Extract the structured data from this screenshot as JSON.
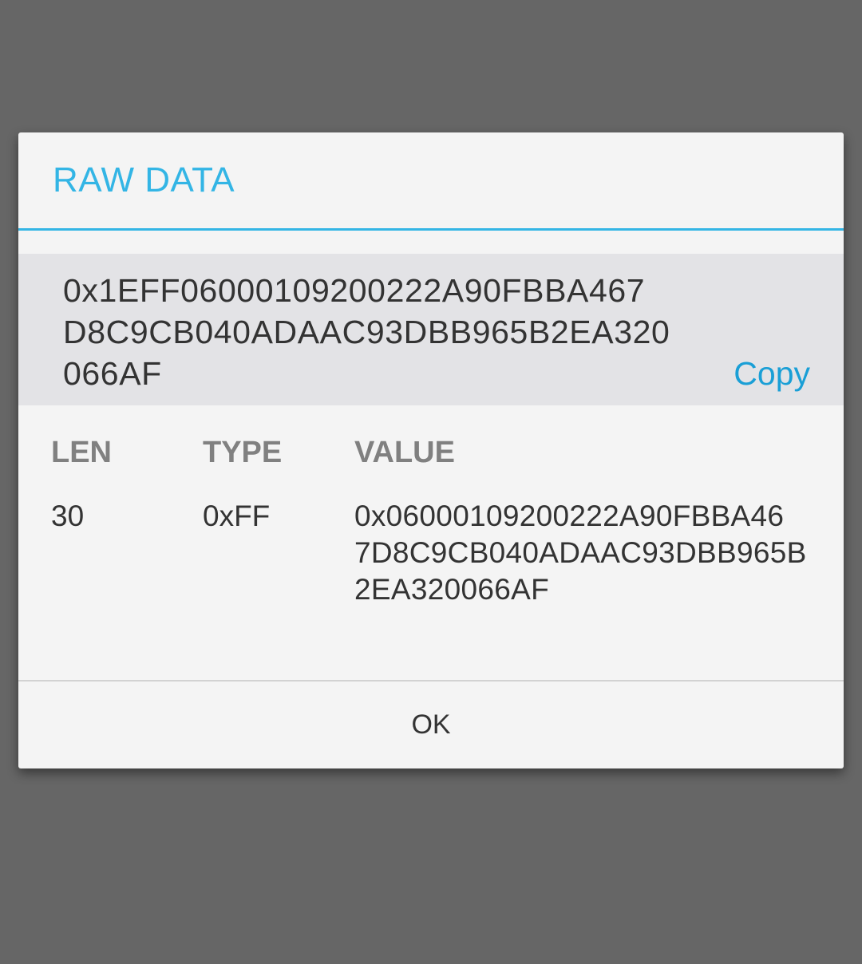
{
  "dialog": {
    "title": "RAW DATA",
    "raw_hex_lines": [
      "0x1EFF06000109200222A90FBBA467",
      "D8C9CB040ADAAC93DBB965B2EA320",
      "066AF"
    ],
    "copy_label": "Copy",
    "table": {
      "headers": [
        "LEN",
        "TYPE",
        "VALUE"
      ],
      "rows": [
        {
          "len": "30",
          "type": "0xFF",
          "value_lines": [
            "0x06000109200222A90FBBA46",
            "7D8C9CB040ADAAC93DBB965B",
            "2EA320066AF"
          ]
        }
      ]
    },
    "ok_label": "OK"
  },
  "colors": {
    "accent": "#33b5e5",
    "scrim": "#666666",
    "dialog_bg": "#f4f4f4",
    "raw_panel_bg": "#e3e3e6"
  }
}
